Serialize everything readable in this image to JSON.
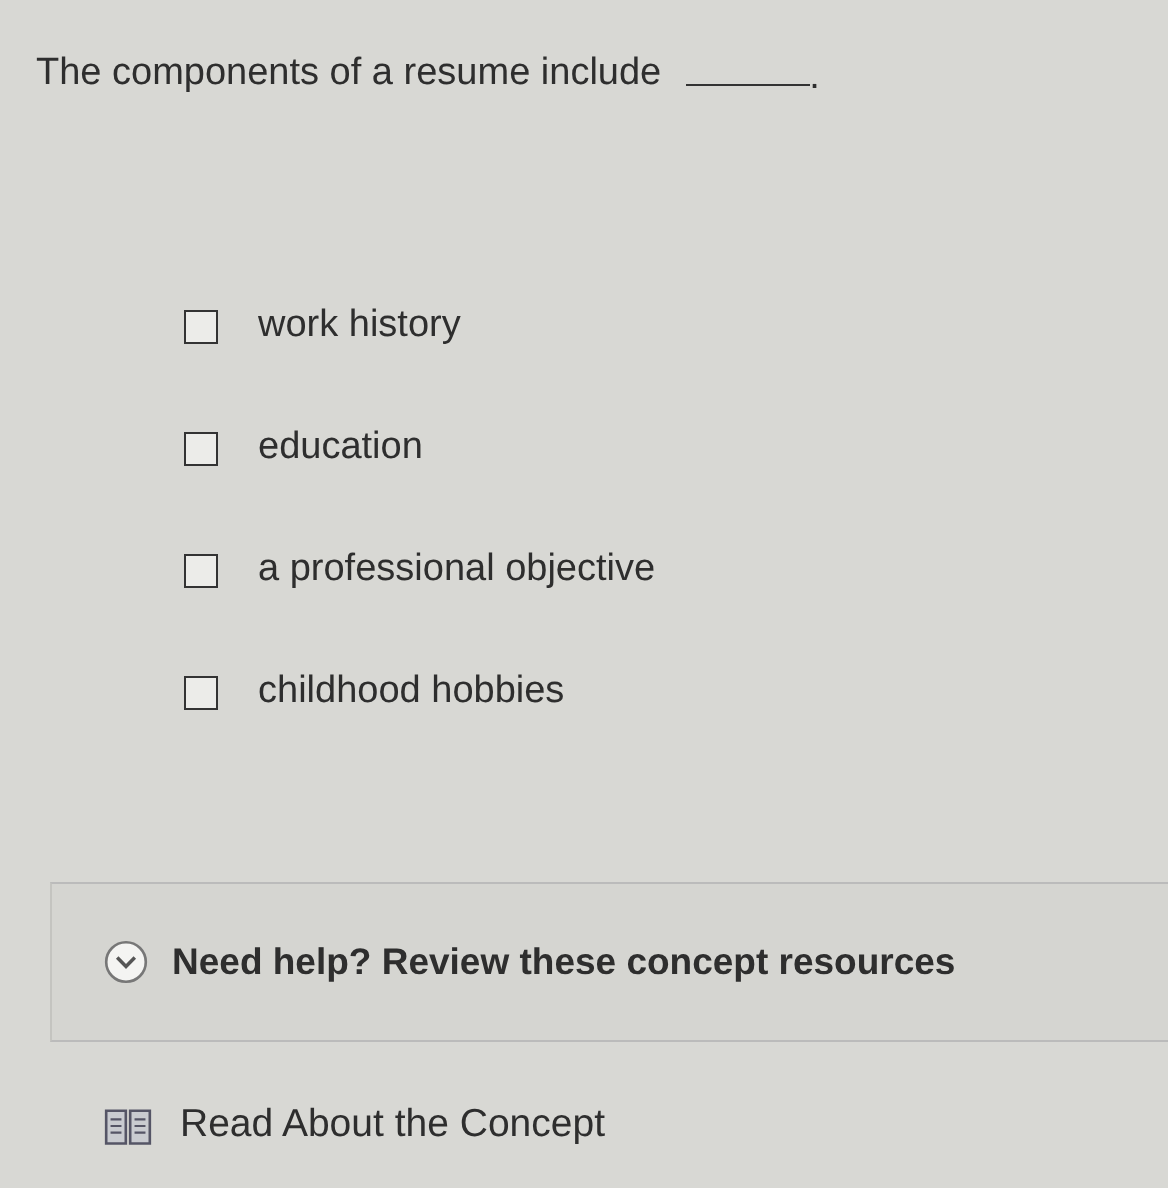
{
  "question": {
    "text": "The components of a resume include",
    "end": "."
  },
  "options": [
    {
      "label": "work history",
      "checked": false
    },
    {
      "label": "education",
      "checked": false
    },
    {
      "label": "a professional objective",
      "checked": false
    },
    {
      "label": "childhood hobbies",
      "checked": false
    }
  ],
  "help": {
    "text": "Need help? Review these concept resources"
  },
  "resources": [
    {
      "label": "Read About the Concept"
    }
  ]
}
